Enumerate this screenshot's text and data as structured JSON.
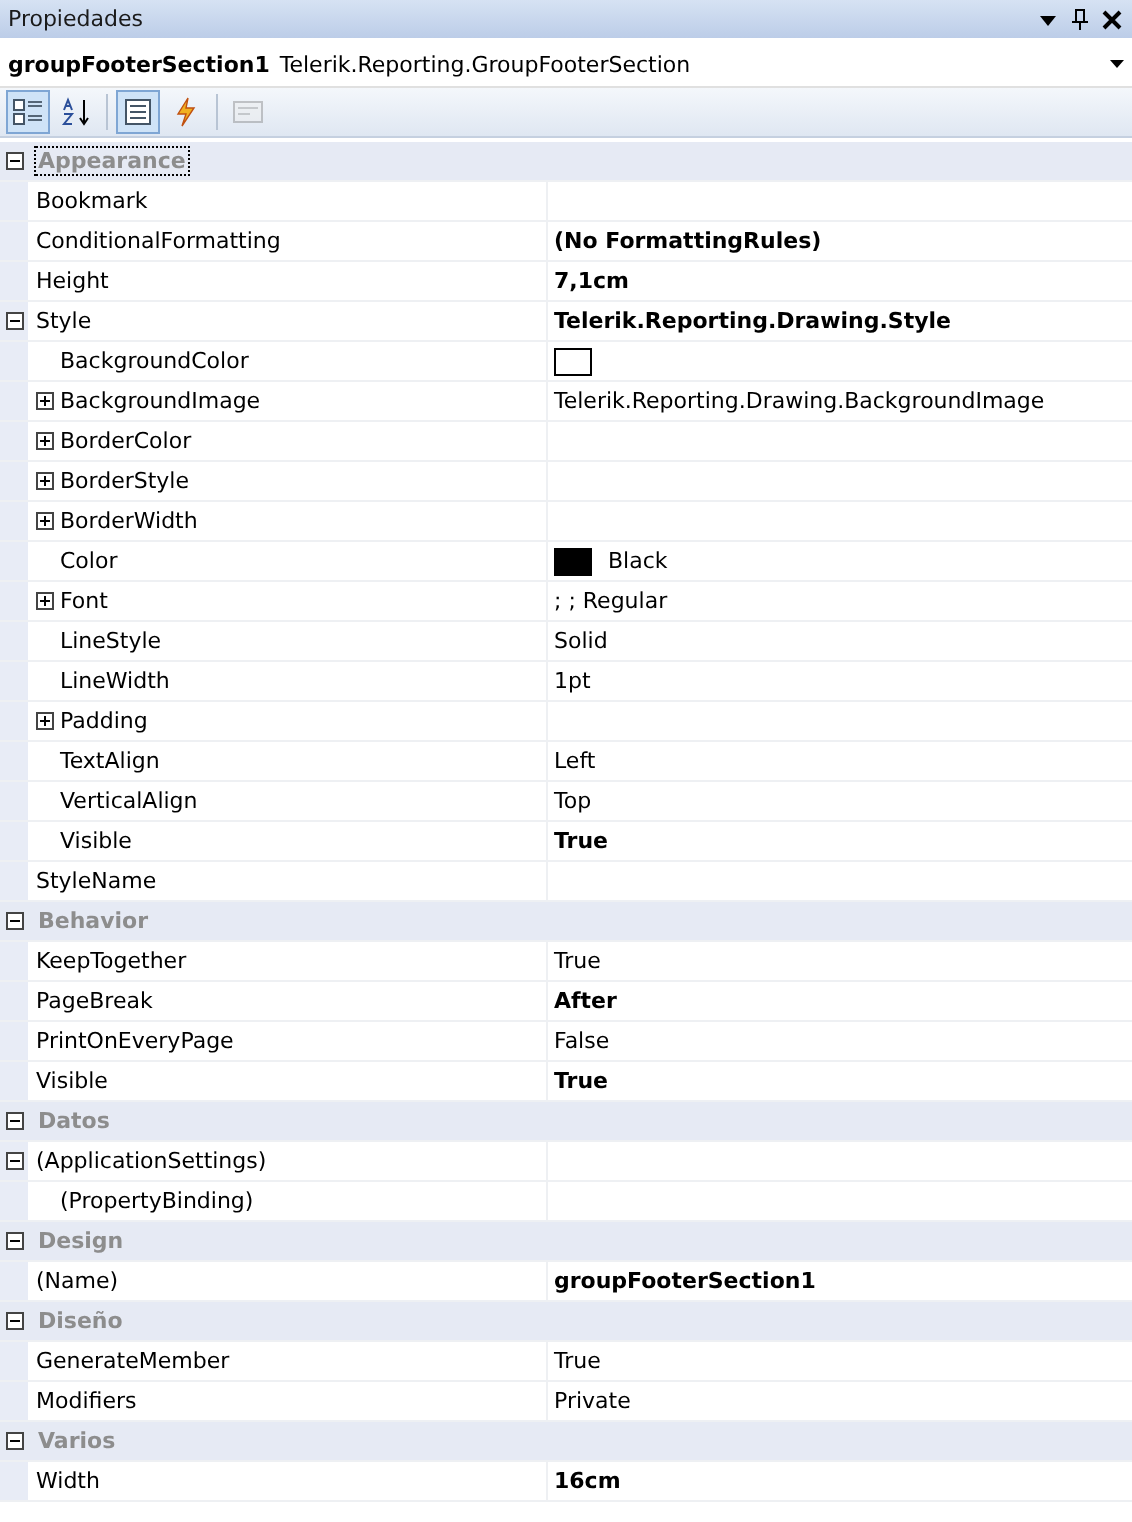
{
  "window": {
    "title": "Propiedades"
  },
  "object_selector": {
    "name": "groupFooterSection1",
    "type": "Telerik.Reporting.GroupFooterSection"
  },
  "toolbar": [
    {
      "kind": "categorized",
      "selected": true,
      "disabled": false
    },
    {
      "kind": "alphabetical",
      "selected": false,
      "disabled": false
    },
    {
      "kind": "properties",
      "selected": true,
      "disabled": false
    },
    {
      "kind": "events",
      "selected": false,
      "disabled": false
    },
    {
      "kind": "pages",
      "selected": false,
      "disabled": true
    }
  ],
  "categories": [
    {
      "name": "Appearance",
      "expanded": true,
      "focused": true,
      "children": [
        {
          "name": "Bookmark",
          "kind": "plain"
        },
        {
          "name": "ConditionalFormatting",
          "kind": "plain",
          "value": "(No FormattingRules)",
          "bold": true
        },
        {
          "name": "Height",
          "kind": "plain",
          "value": "7,1cm",
          "bold": true
        },
        {
          "name": "Style",
          "kind": "expandable",
          "expanded": true,
          "value": "Telerik.Reporting.Drawing.Style",
          "bold": true,
          "children": [
            {
              "name": "BackgroundColor",
              "kind": "plain",
              "color": "#ffffff"
            },
            {
              "name": "BackgroundImage",
              "kind": "expandable",
              "expanded": false,
              "value": "Telerik.Reporting.Drawing.BackgroundImage",
              "bold": false
            },
            {
              "name": "BorderColor",
              "kind": "expandable",
              "expanded": false
            },
            {
              "name": "BorderStyle",
              "kind": "expandable",
              "expanded": false
            },
            {
              "name": "BorderWidth",
              "kind": "expandable",
              "expanded": false
            },
            {
              "name": "Color",
              "kind": "plain",
              "color": "#000000",
              "value": "Black",
              "bold": false
            },
            {
              "name": "Font",
              "kind": "expandable",
              "expanded": false,
              "value": "; ; Regular",
              "bold": false
            },
            {
              "name": "LineStyle",
              "kind": "plain",
              "value": "Solid",
              "bold": false
            },
            {
              "name": "LineWidth",
              "kind": "plain",
              "value": "1pt",
              "bold": false
            },
            {
              "name": "Padding",
              "kind": "expandable",
              "expanded": false
            },
            {
              "name": "TextAlign",
              "kind": "plain",
              "value": "Left",
              "bold": false
            },
            {
              "name": "VerticalAlign",
              "kind": "plain",
              "value": "Top",
              "bold": false
            },
            {
              "name": "Visible",
              "kind": "plain",
              "value": "True",
              "bold": true
            }
          ]
        },
        {
          "name": "StyleName",
          "kind": "plain"
        }
      ]
    },
    {
      "name": "Behavior",
      "expanded": true,
      "focused": false,
      "children": [
        {
          "name": "KeepTogether",
          "kind": "plain",
          "value": "True",
          "bold": false
        },
        {
          "name": "PageBreak",
          "kind": "plain",
          "value": "After",
          "bold": true
        },
        {
          "name": "PrintOnEveryPage",
          "kind": "plain",
          "value": "False",
          "bold": false
        },
        {
          "name": "Visible",
          "kind": "plain",
          "value": "True",
          "bold": true
        }
      ]
    },
    {
      "name": "Datos",
      "expanded": true,
      "focused": false,
      "children": [
        {
          "name": "(ApplicationSettings)",
          "kind": "expandable",
          "expanded": true,
          "children": [
            {
              "name": "(PropertyBinding)",
              "kind": "plain"
            }
          ]
        }
      ]
    },
    {
      "name": "Design",
      "expanded": true,
      "focused": false,
      "children": [
        {
          "name": "(Name)",
          "kind": "plain",
          "value": "groupFooterSection1",
          "bold": true
        }
      ]
    },
    {
      "name": "Diseño",
      "expanded": true,
      "focused": false,
      "children": [
        {
          "name": "GenerateMember",
          "kind": "plain",
          "value": "True",
          "bold": false
        },
        {
          "name": "Modifiers",
          "kind": "plain",
          "value": "Private",
          "bold": false
        }
      ]
    },
    {
      "name": "Varios",
      "expanded": true,
      "focused": false,
      "children": [
        {
          "name": "Width",
          "kind": "plain",
          "value": "16cm",
          "bold": true
        }
      ]
    }
  ]
}
